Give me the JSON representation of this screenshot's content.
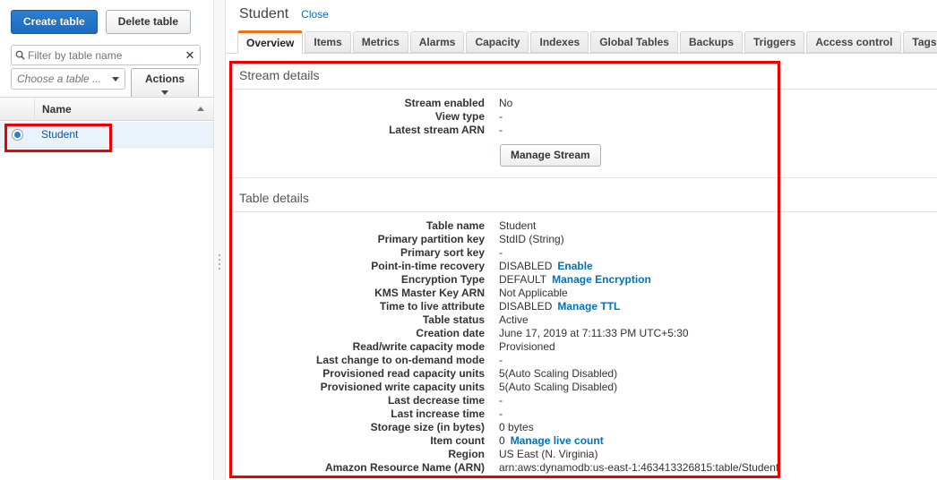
{
  "sidebar": {
    "create_table_label": "Create table",
    "delete_table_label": "Delete table",
    "filter": {
      "placeholder": "Filter by table name",
      "value": "",
      "icon": "search-icon",
      "clear_icon": "✕"
    },
    "chooser": {
      "label": "Choose a table ...",
      "actions_label": "Actions"
    },
    "table": {
      "column_header": "Name",
      "sort_direction": "asc",
      "rows": [
        {
          "name": "Student",
          "selected": true
        }
      ]
    }
  },
  "main": {
    "title": "Student",
    "close_label": "Close",
    "tabs": [
      {
        "label": "Overview",
        "active": true
      },
      {
        "label": "Items",
        "active": false
      },
      {
        "label": "Metrics",
        "active": false
      },
      {
        "label": "Alarms",
        "active": false
      },
      {
        "label": "Capacity",
        "active": false
      },
      {
        "label": "Indexes",
        "active": false
      },
      {
        "label": "Global Tables",
        "active": false
      },
      {
        "label": "Backups",
        "active": false
      },
      {
        "label": "Triggers",
        "active": false
      },
      {
        "label": "Access control",
        "active": false
      },
      {
        "label": "Tags",
        "active": false
      }
    ],
    "stream_details": {
      "heading": "Stream details",
      "rows": [
        {
          "label": "Stream enabled",
          "value": "No",
          "link": ""
        },
        {
          "label": "View type",
          "value": "-",
          "link": ""
        },
        {
          "label": "Latest stream ARN",
          "value": "-",
          "link": ""
        }
      ],
      "manage_stream_label": "Manage Stream"
    },
    "table_details": {
      "heading": "Table details",
      "rows": [
        {
          "label": "Table name",
          "value": "Student",
          "link": ""
        },
        {
          "label": "Primary partition key",
          "value": "StdID (String)",
          "link": ""
        },
        {
          "label": "Primary sort key",
          "value": "-",
          "link": ""
        },
        {
          "label": "Point-in-time recovery",
          "value": "DISABLED",
          "link": "Enable"
        },
        {
          "label": "Encryption Type",
          "value": "DEFAULT",
          "link": "Manage Encryption"
        },
        {
          "label": "KMS Master Key ARN",
          "value": "Not Applicable",
          "link": ""
        },
        {
          "label": "Time to live attribute",
          "value": "DISABLED",
          "link": "Manage TTL"
        },
        {
          "label": "Table status",
          "value": "Active",
          "link": ""
        },
        {
          "label": "Creation date",
          "value": "June 17, 2019 at 7:11:33 PM UTC+5:30",
          "link": ""
        },
        {
          "label": "Read/write capacity mode",
          "value": "Provisioned",
          "link": ""
        },
        {
          "label": "Last change to on-demand mode",
          "value": "-",
          "link": ""
        },
        {
          "label": "Provisioned read capacity units",
          "value": "5(Auto Scaling Disabled)",
          "link": ""
        },
        {
          "label": "Provisioned write capacity units",
          "value": "5(Auto Scaling Disabled)",
          "link": ""
        },
        {
          "label": "Last decrease time",
          "value": "-",
          "link": ""
        },
        {
          "label": "Last increase time",
          "value": "-",
          "link": ""
        },
        {
          "label": "Storage size (in bytes)",
          "value": "0 bytes",
          "link": ""
        },
        {
          "label": "Item count",
          "value": "0",
          "link": "Manage live count"
        },
        {
          "label": "Region",
          "value": "US East (N. Virginia)",
          "link": ""
        },
        {
          "label": "Amazon Resource Name (ARN)",
          "value": "arn:aws:dynamodb:us-east-1:463413326815:table/Student",
          "link": ""
        }
      ]
    }
  },
  "colors": {
    "primary_button": "#1e6bbd",
    "link": "#0073bb",
    "active_tab_accent": "#ec7211",
    "annotation": "#ee0000",
    "selected_row": "#eaf3fb"
  }
}
